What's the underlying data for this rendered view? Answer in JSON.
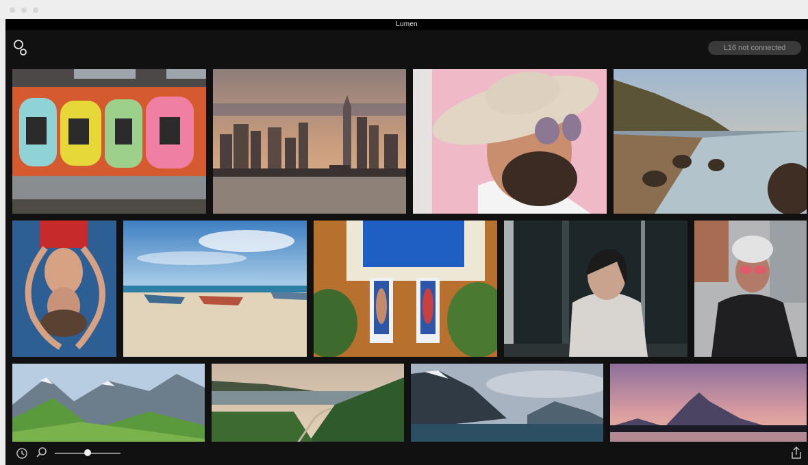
{
  "window": {
    "title": "Lumen"
  },
  "toolbar": {
    "status": "L16 not connected",
    "logo_icon": "lumen-logo-icon"
  },
  "bottom_bar": {
    "icons": [
      "clock-icon",
      "search-icon",
      "share-icon"
    ],
    "zoom_level": 0.5
  },
  "photos": [
    {
      "subject": "graffiti wall"
    },
    {
      "subject": "city skyline at sunset"
    },
    {
      "subject": "man with hat and sunglasses"
    },
    {
      "subject": "rocky beach at sunset"
    },
    {
      "subject": "woman floating in pool"
    },
    {
      "subject": "boats on beach"
    },
    {
      "subject": "pool with loungers"
    },
    {
      "subject": "woman in white jacket"
    },
    {
      "subject": "woman with sunglasses"
    },
    {
      "subject": "green mountains"
    },
    {
      "subject": "valley road"
    },
    {
      "subject": "mountain lake"
    },
    {
      "subject": "mountain sunset"
    }
  ],
  "colors": {
    "background": "#111111",
    "status_pill": "#3a3a3a"
  }
}
